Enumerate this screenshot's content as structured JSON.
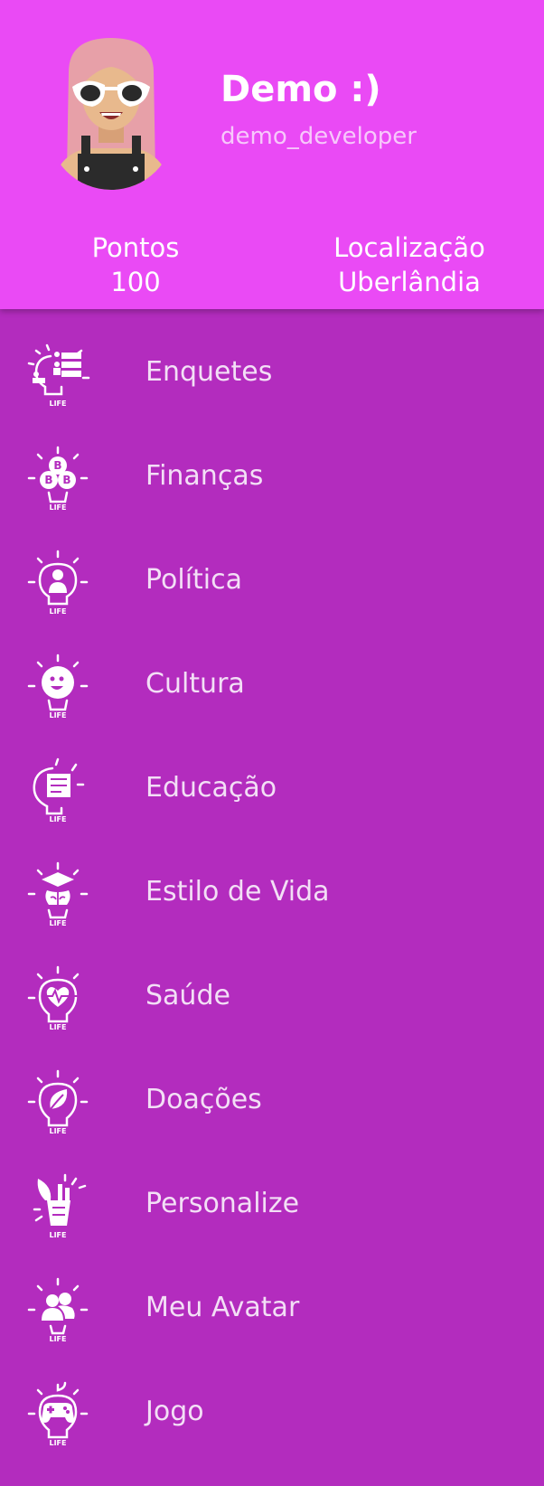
{
  "profile": {
    "name": "Demo :)",
    "handle": "demo_developer"
  },
  "stats": {
    "points_label": "Pontos",
    "points_value": "100",
    "location_label": "Localização",
    "location_value": "Uberlândia"
  },
  "menu": [
    {
      "label": "Enquetes",
      "icon": "poll-bulb-icon"
    },
    {
      "label": "Finanças",
      "icon": "bitcoin-bulb-icon"
    },
    {
      "label": "Política",
      "icon": "politician-bulb-icon"
    },
    {
      "label": "Cultura",
      "icon": "theater-masks-bulb-icon"
    },
    {
      "label": "Educação",
      "icon": "chalkboard-bulb-icon"
    },
    {
      "label": "Estilo de Vida",
      "icon": "graduation-brain-bulb-icon"
    },
    {
      "label": "Saúde",
      "icon": "heartbeat-bulb-icon"
    },
    {
      "label": "Doações",
      "icon": "leaf-bulb-icon"
    },
    {
      "label": "Personalize",
      "icon": "paint-tools-bulb-icon"
    },
    {
      "label": "Meu Avatar",
      "icon": "users-bulb-icon"
    },
    {
      "label": "Jogo",
      "icon": "gamepad-bulb-icon"
    }
  ],
  "icon_caption": "LIFE",
  "colors": {
    "header": "#ea4af5",
    "background": "#b32cbe",
    "text": "#ffffff"
  }
}
